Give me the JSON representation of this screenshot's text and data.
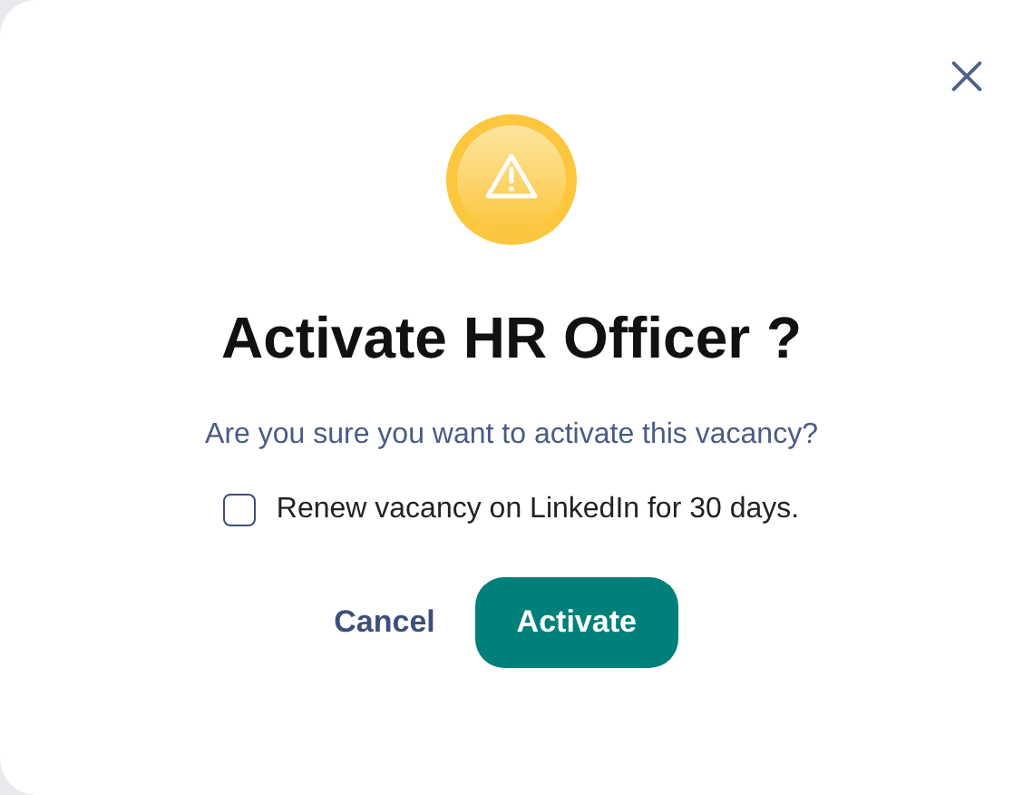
{
  "dialog": {
    "title": "Activate HR Officer ?",
    "message": "Are you sure you want to activate this vacancy?",
    "option": {
      "label": "Renew vacancy on LinkedIn for 30 days.",
      "checked": false
    },
    "buttons": [
      {
        "label": "Cancel",
        "kind": "secondary"
      },
      {
        "label": "Activate",
        "kind": "primary"
      }
    ]
  }
}
